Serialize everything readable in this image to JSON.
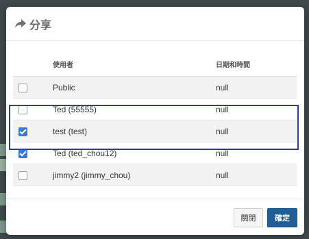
{
  "dialog": {
    "title": "分享",
    "icon": "share-icon"
  },
  "table": {
    "headers": {
      "user": "使用者",
      "datetime": "日期和時間"
    },
    "rows": [
      {
        "user": "Public",
        "datetime": "null",
        "checked": false
      },
      {
        "user": "Ted (55555)",
        "datetime": "null",
        "checked": false
      },
      {
        "user": "test (test)",
        "datetime": "null",
        "checked": true
      },
      {
        "user": "Ted (ted_chou12)",
        "datetime": "null",
        "checked": true
      },
      {
        "user": "jimmy2 (jimmy_chou)",
        "datetime": "null",
        "checked": false
      }
    ]
  },
  "footer": {
    "close_label": "關閉",
    "confirm_label": "確定"
  },
  "colors": {
    "highlight": "#2a3fa6",
    "checkbox_checked": "#2f7de1",
    "confirm_button": "#1f5f97"
  }
}
